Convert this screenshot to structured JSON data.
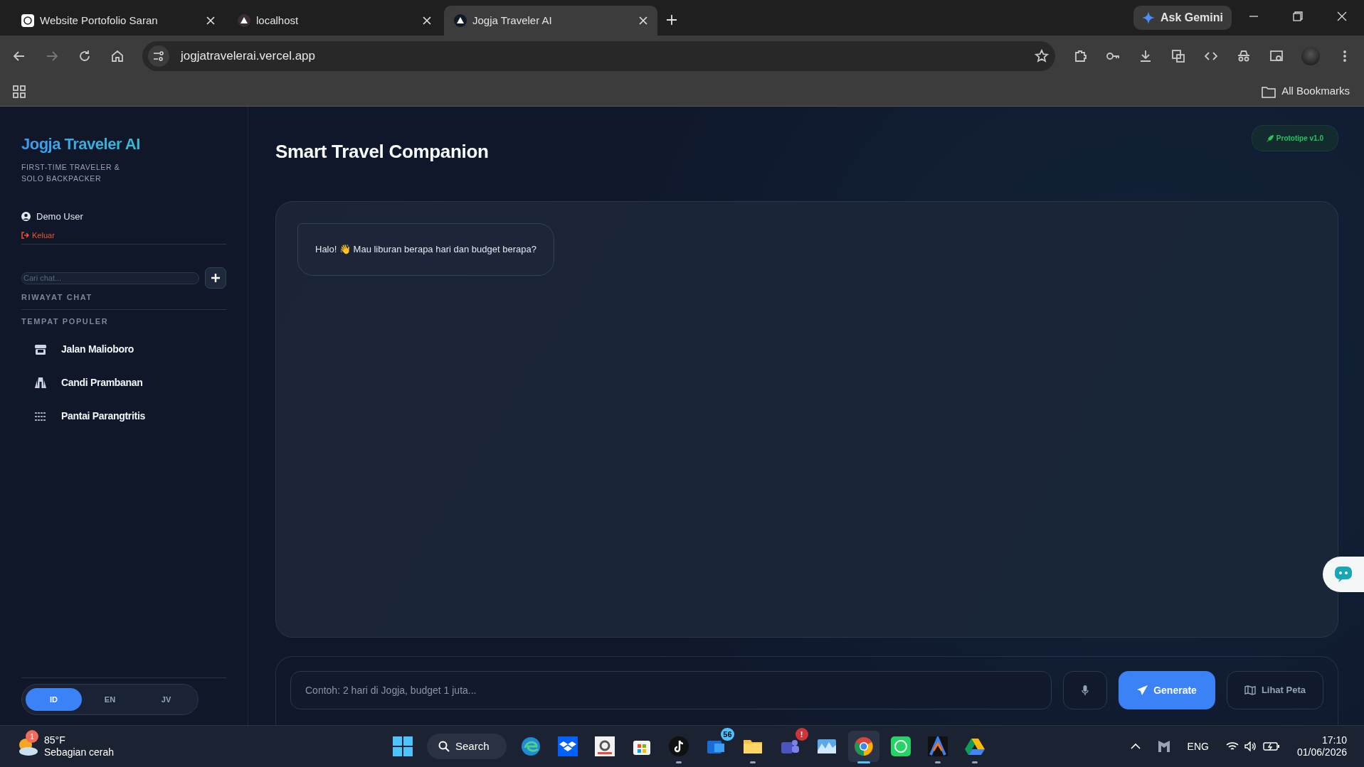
{
  "browser": {
    "tabs": [
      {
        "title": "Website Portofolio Saran",
        "selected": false
      },
      {
        "title": "localhost",
        "selected": false
      },
      {
        "title": "Jogja Traveler AI",
        "selected": true
      }
    ],
    "ask_gemini": "Ask Gemini",
    "address": "jogjatravelerai.vercel.app",
    "bookmarks_label": "All Bookmarks"
  },
  "sidebar": {
    "brand": "Jogja Traveler AI",
    "tagline": "FIRST-TIME TRAVELER & SOLO BACKPACKER",
    "user": "Demo User",
    "logout": "Keluar",
    "search": {
      "placeholder": "Cari chat..."
    },
    "history_heading": "RIWAYAT CHAT",
    "popular_heading": "TEMPAT POPULER",
    "places": [
      {
        "name": "Jalan Malioboro"
      },
      {
        "name": "Candi Prambanan"
      },
      {
        "name": "Pantai Parangtritis"
      }
    ],
    "languages": [
      {
        "label": "ID",
        "selected": true
      },
      {
        "label": "EN",
        "selected": false
      },
      {
        "label": "JV",
        "selected": false
      }
    ]
  },
  "main": {
    "title": "Smart Travel Companion",
    "badge": "Prototipe v1.0",
    "messages": [
      {
        "text": "Halo! 👋 Mau liburan berapa hari dan budget berapa?"
      }
    ],
    "input": {
      "placeholder": "Contoh: 2 hari di Jogja, budget 1 juta..."
    },
    "generate": "Generate",
    "map": "Lihat Peta"
  },
  "taskbar": {
    "temperature": "85°F",
    "condition": "Sebagian cerah",
    "weather_badge": "1",
    "search": "Search",
    "apps": [
      {
        "running": false,
        "selected": false
      },
      {
        "running": false,
        "selected": false
      },
      {
        "running": false,
        "selected": false
      },
      {
        "running": false,
        "selected": false
      },
      {
        "running": true,
        "selected": false
      },
      {
        "running": false,
        "selected": false,
        "badge": "56"
      },
      {
        "running": true,
        "selected": false
      },
      {
        "running": false,
        "selected": false,
        "badge": "!"
      },
      {
        "running": false,
        "selected": false
      },
      {
        "running": true,
        "selected": true
      },
      {
        "running": false,
        "selected": false
      },
      {
        "running": true,
        "selected": false
      },
      {
        "running": true,
        "selected": false
      }
    ],
    "language": "ENG",
    "time": "17:10",
    "date": "01/06/2026"
  }
}
